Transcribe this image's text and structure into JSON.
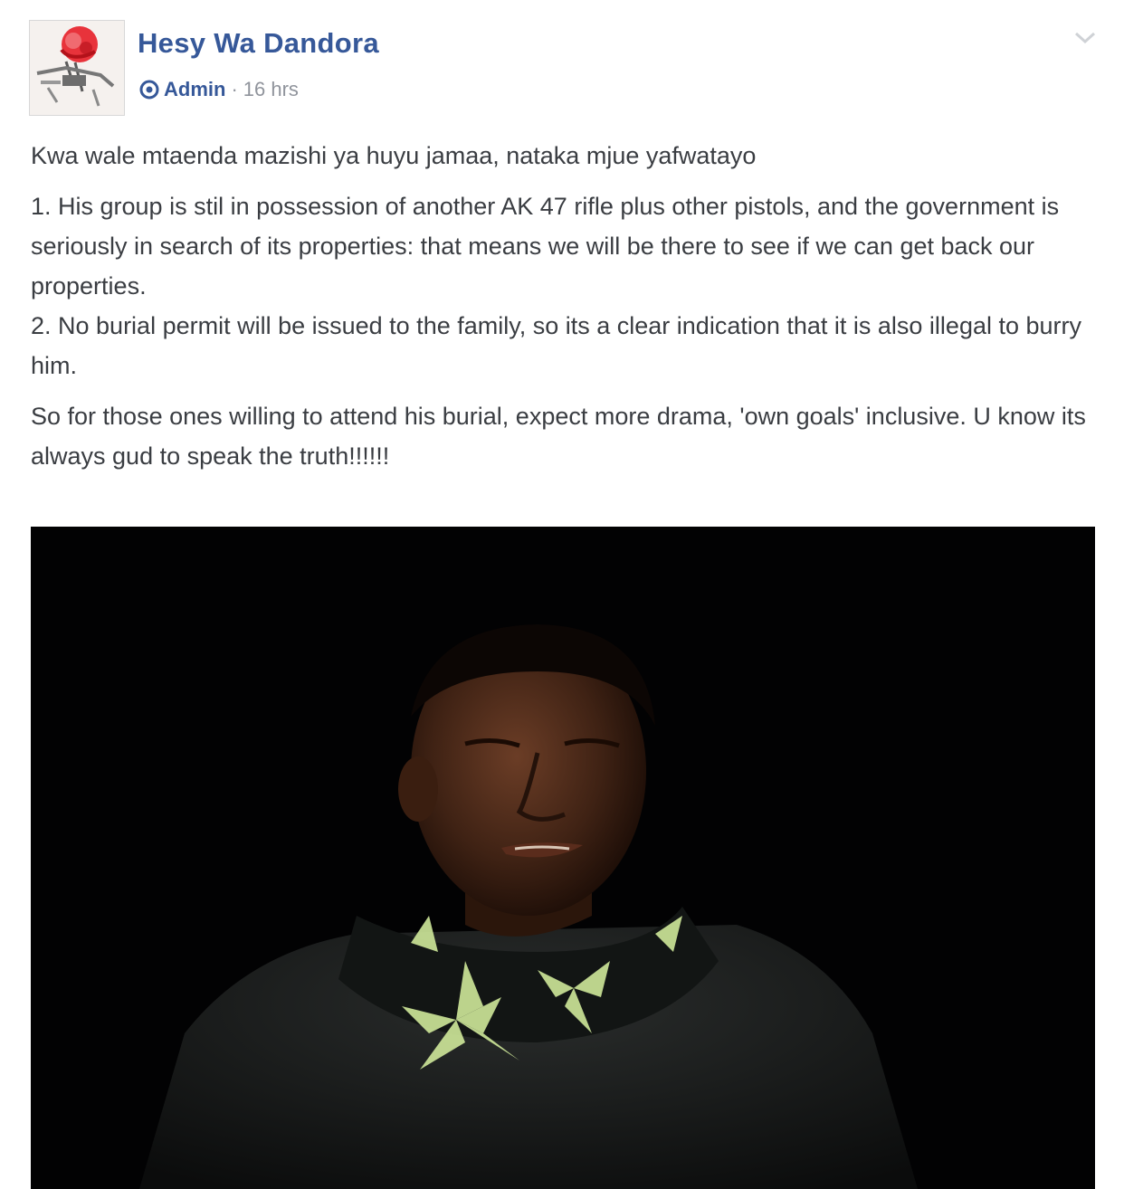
{
  "post": {
    "author": {
      "name": "Hesy Wa Dandora",
      "avatar_icon": "group-avatar-rose-icon"
    },
    "meta": {
      "role_icon": "admin-badge-icon",
      "role": "Admin",
      "separator": "·",
      "timestamp": "16 hrs"
    },
    "menu_icon": "chevron-down-icon",
    "body": {
      "intro": "Kwa wale mtaenda mazishi ya huyu jamaa, nataka mjue yafwatayo",
      "point_1": "1. His group is stil in possession of another AK 47 rifle plus other pistols, and the government is seriously in search of its properties: that means we will be there to see if we can get back our properties.",
      "point_2": "2. No burial permit will be issued to the family, so its a clear indication that it is also illegal to burry him.",
      "closing": "So for those ones willing to attend his burial, expect more drama, 'own goals' inclusive. U know its always gud to speak the truth!!!!!!"
    },
    "photo": {
      "alt": "photo-of-young-man"
    }
  },
  "colors": {
    "author_blue": "#365899",
    "meta_gray": "#90949c",
    "body_text": "#3a3d42",
    "photo_bg": "#020203"
  }
}
